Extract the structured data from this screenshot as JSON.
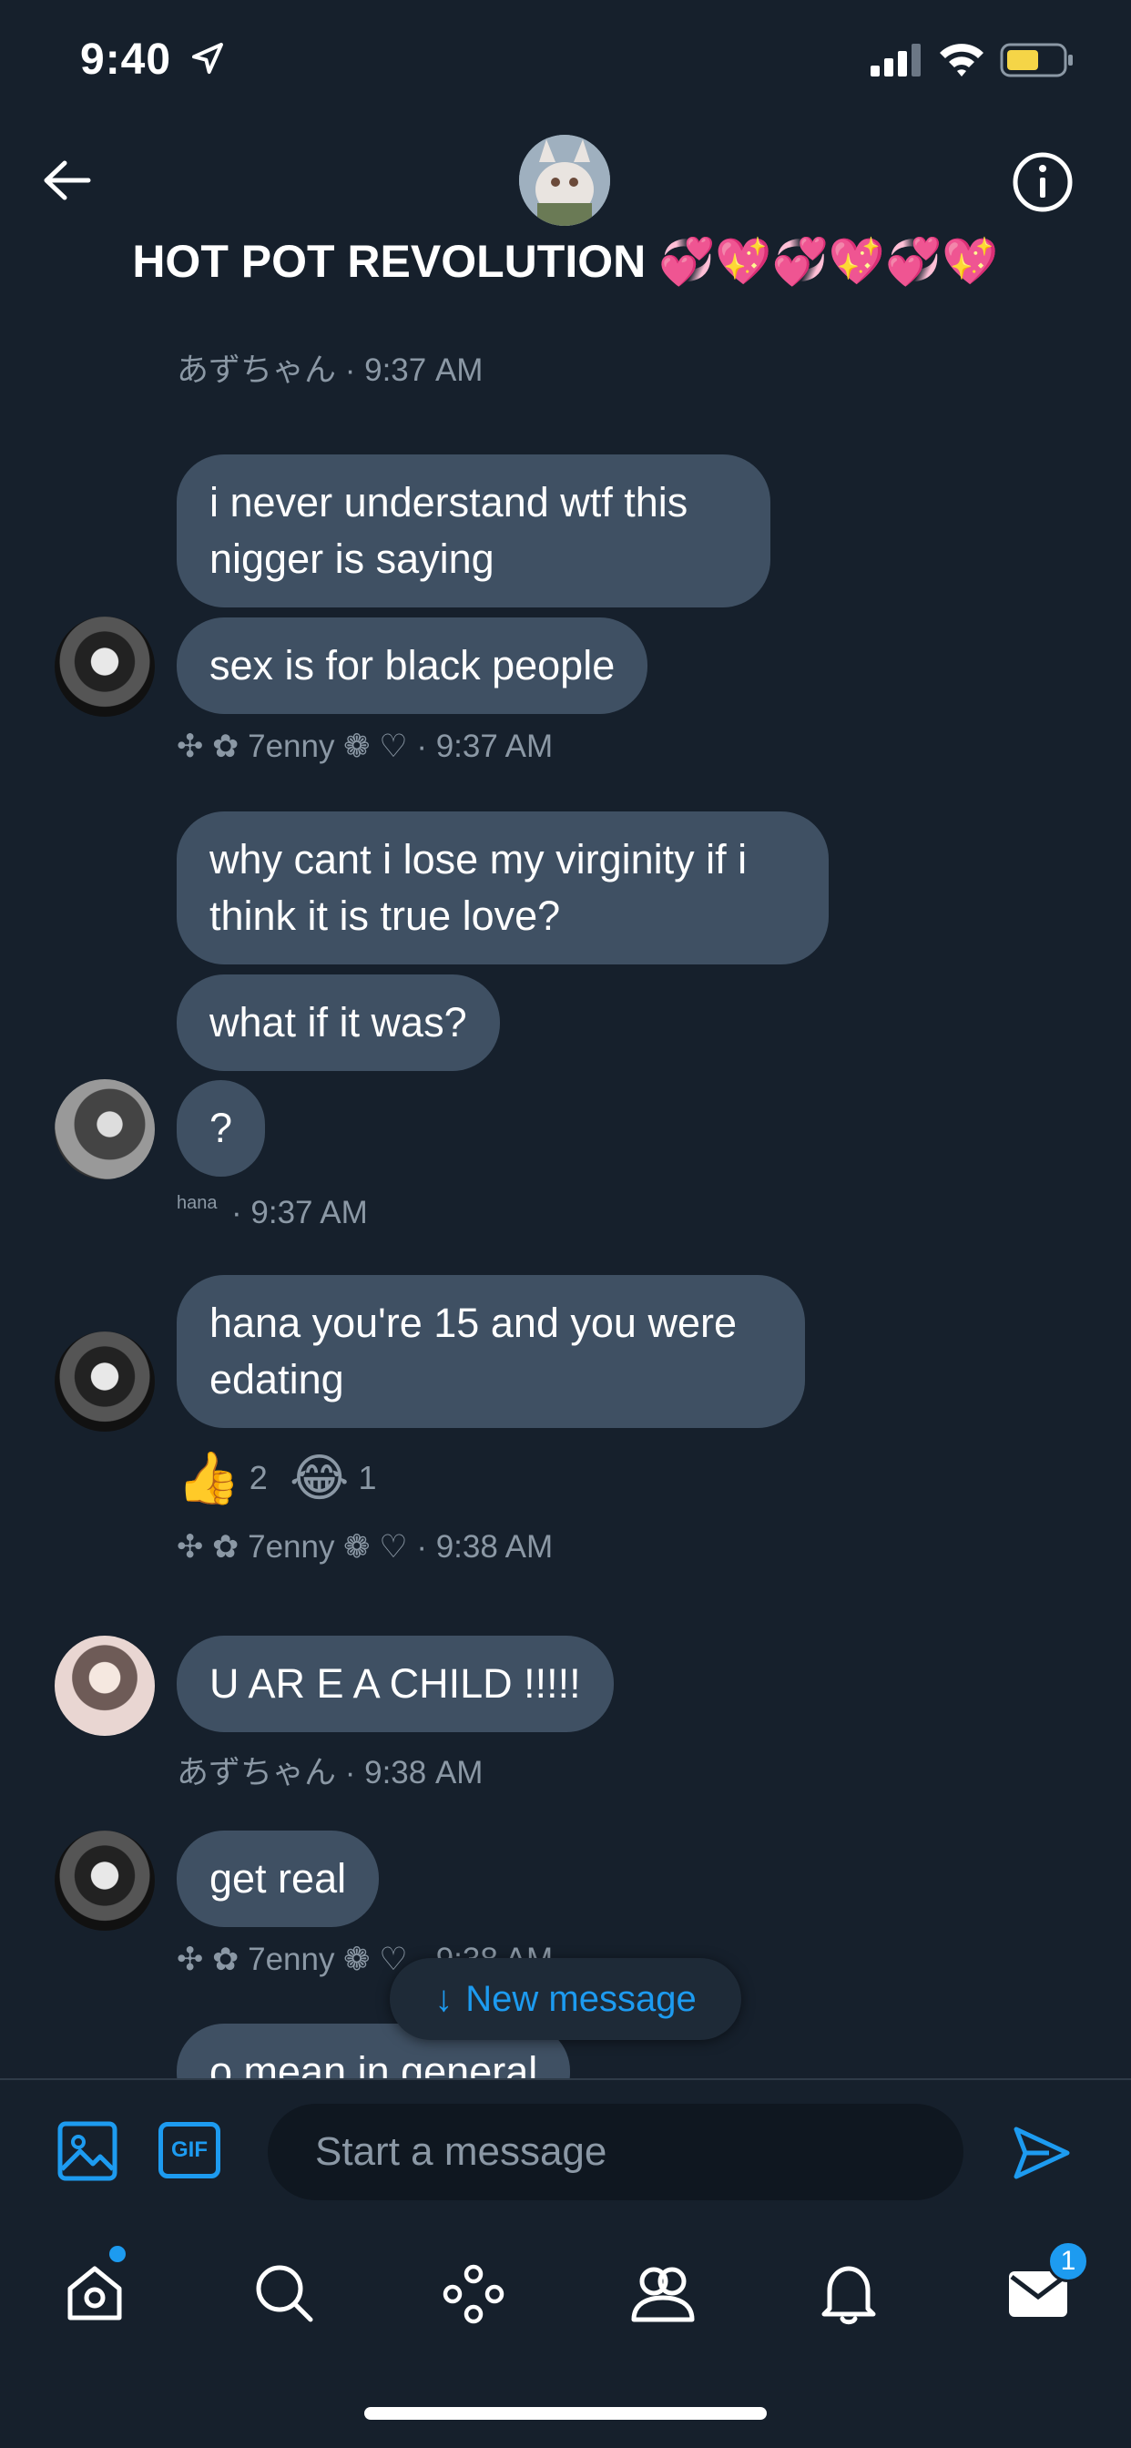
{
  "status_bar": {
    "time": "9:40"
  },
  "header": {
    "title": "HOT POT REVOLUTION 💞💖💞💖💞💖"
  },
  "messages": [
    {
      "meta": "あずちゃん · 9:37 AM"
    },
    {
      "bubbles": [
        "i never understand wtf this\nnigger is saying",
        "sex is for black people"
      ],
      "meta": "✣ ✿ 7enny ❁ ♡ · 9:37 AM"
    },
    {
      "bubbles": [
        "why cant i lose my virginity if i\nthink it is true love?",
        "what if it was?",
        "?"
      ],
      "meta_small": "hana",
      "meta": "· 9:37 AM"
    },
    {
      "bubbles": [
        "hana you're 15 and you were\nedating"
      ],
      "reactions": [
        {
          "emoji": "👍",
          "count": "2"
        },
        {
          "emoji": "😂",
          "count": "1"
        }
      ],
      "meta": "✣ ✿ 7enny ❁ ♡ · 9:38 AM"
    },
    {
      "bubbles": [
        "U AR E A CHILD !!!!!"
      ],
      "meta": "あずちゃん · 9:38 AM"
    },
    {
      "bubbles": [
        "get real"
      ],
      "meta": "✣ ✿ 7enny ❁ ♡ · 9:38 AM"
    },
    {
      "bubbles": [
        "o mean in general"
      ]
    }
  ],
  "new_message_pill": {
    "arrow": "↓",
    "label": "New message"
  },
  "composer": {
    "gif_label": "GIF",
    "placeholder": "Start a message"
  },
  "tab_bar": {
    "messages_badge": "1"
  },
  "colors": {
    "background": "#16202c",
    "bubble": "#3f5063",
    "accent": "#1d9bf0",
    "meta": "#8b98a5"
  }
}
